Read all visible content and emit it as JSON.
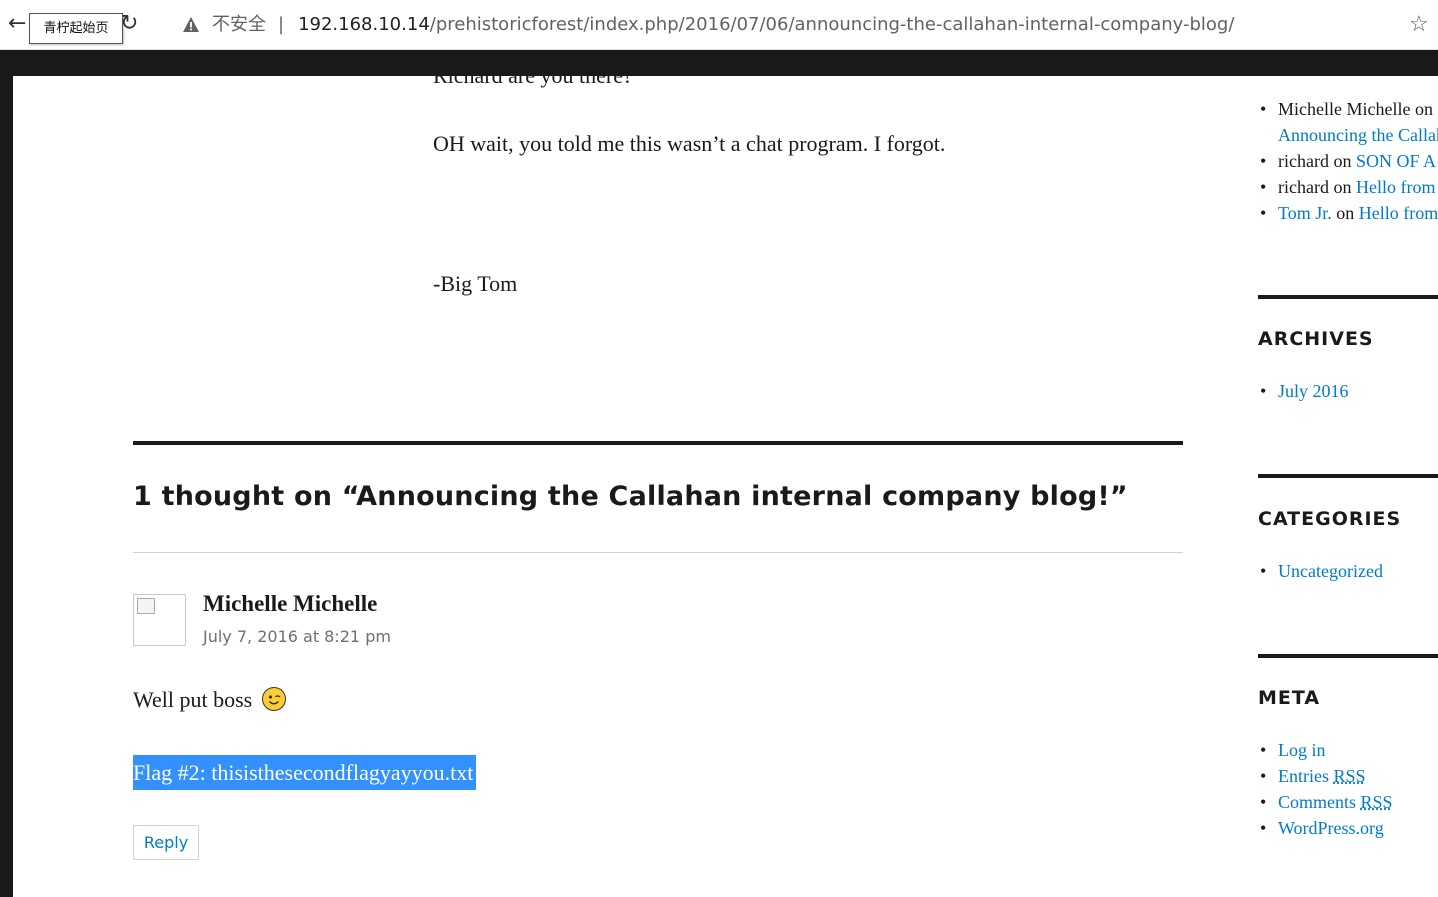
{
  "browser": {
    "tooltip": "青柠起始页",
    "insecure_label": "不安全",
    "separator": "|",
    "url_host": "192.168.10.14",
    "url_path": "/prehistoricforest/index.php/2016/07/06/announcing-the-callahan-internal-company-blog/",
    "back_icon": "back-arrow-icon",
    "reload_icon": "reload-icon",
    "warning_icon": "warning-triangle-icon",
    "bookmark_icon": "star-icon"
  },
  "article": {
    "cut_line": "Richard are you there?",
    "paragraph_1": "OH wait, you told me this wasn’t a chat program.  I forgot.",
    "signature": "-Big Tom"
  },
  "comments": {
    "title": "1 thought on “Announcing the Callahan internal company blog!”",
    "items": [
      {
        "author": "Michelle Michelle",
        "date": "July 7, 2016 at 8:21 pm",
        "text": "Well put boss",
        "flag": "Flag #2: thisisthesecondflagyayyou.txt",
        "reply_label": "Reply"
      }
    ]
  },
  "sidebar": {
    "recent_comments": [
      {
        "author": "Michelle Michelle",
        "on": " on ",
        "post": "Announcing the Callahan internal company blog!"
      },
      {
        "author": "richard",
        "on": " on ",
        "post": "SON OF A!"
      },
      {
        "author": "richard",
        "on": " on ",
        "post": "Hello from Tom"
      },
      {
        "author": "Tom Jr.",
        "on": " on ",
        "post": "Hello from Tom"
      }
    ],
    "archives": {
      "title": "ARCHIVES",
      "items": [
        "July 2016"
      ]
    },
    "categories": {
      "title": "CATEGORIES",
      "items": [
        "Uncategorized"
      ]
    },
    "meta": {
      "title": "META",
      "log_in": "Log in",
      "entries": "Entries ",
      "comments": "Comments ",
      "rss": "RSS",
      "wordpress": "WordPress.org"
    }
  },
  "colors": {
    "link": "#007acc",
    "selection": "#3390ff",
    "text": "#1a1a1a",
    "meta_text": "#707070"
  }
}
